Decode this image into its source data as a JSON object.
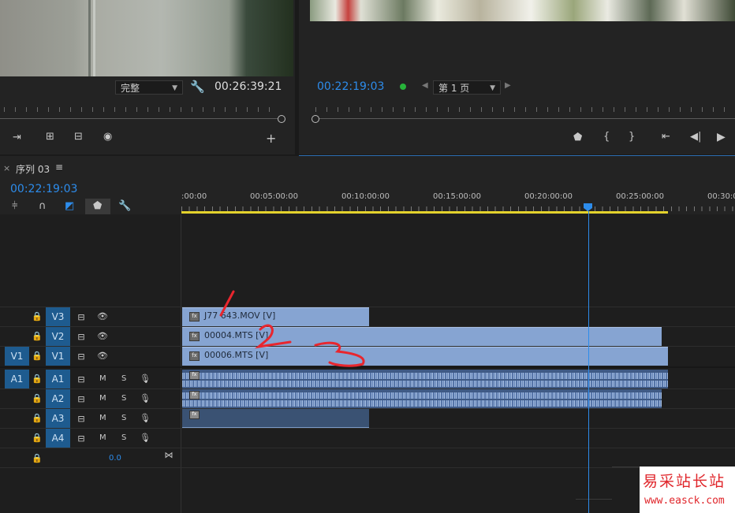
{
  "source_monitor": {
    "fit_select": "完整",
    "timecode": "00:26:39:21"
  },
  "program_monitor": {
    "timecode": "00:22:19:03",
    "page_select": "第 1 页"
  },
  "timeline": {
    "tab_close": "×",
    "tab_title": "序列 03",
    "tab_menu": "≡",
    "timecode": "00:22:19:03",
    "ruler_labels": [
      ":00:00",
      "00:05:00:00",
      "00:10:00:00",
      "00:15:00:00",
      "00:20:00:00",
      "00:25:00:00",
      "00:30:0"
    ],
    "master_volume": "0.0",
    "video_tracks": [
      {
        "id": "V3",
        "source": ""
      },
      {
        "id": "V2",
        "source": ""
      },
      {
        "id": "V1",
        "source": "V1"
      }
    ],
    "audio_tracks": [
      {
        "id": "A1",
        "source": "A1",
        "m": "M",
        "s": "S"
      },
      {
        "id": "A2",
        "source": "",
        "m": "M",
        "s": "S"
      },
      {
        "id": "A3",
        "source": "",
        "m": "M",
        "s": "S"
      },
      {
        "id": "A4",
        "source": "",
        "m": "M",
        "s": "S"
      }
    ],
    "clips": {
      "v3": "J77  643.MOV [V]",
      "v2": "00004.MTS [V]",
      "v1": "00006.MTS [V]",
      "fx": "fx"
    },
    "annotations": [
      "1",
      "2",
      "3"
    ]
  },
  "watermark": {
    "title": "易采站长站",
    "url": "www.easck.com"
  },
  "colors": {
    "accent_blue": "#2d8ceb",
    "track_target": "#1e5b8f",
    "video_clip": "#86a4d2",
    "audio_clip": "#3f5a85",
    "work_area": "#e3d22c",
    "annotation_red": "#e8262e"
  }
}
